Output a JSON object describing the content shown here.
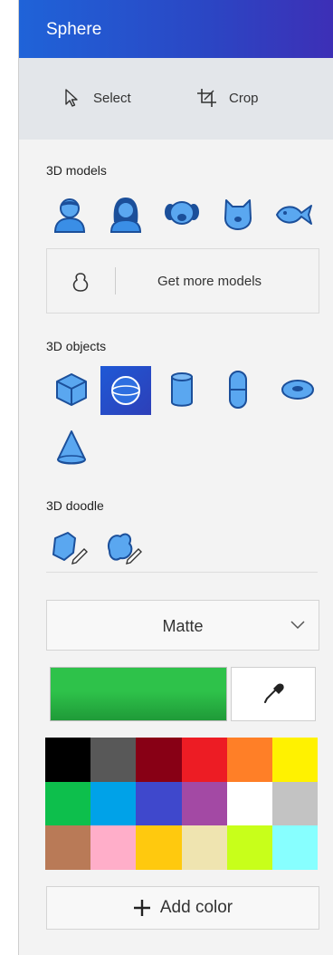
{
  "header": {
    "title": "Sphere"
  },
  "toolbar": {
    "select_label": "Select",
    "crop_label": "Crop"
  },
  "models": {
    "label": "3D models",
    "items": [
      "man-model-icon",
      "woman-model-icon",
      "dog-model-icon",
      "cat-model-icon",
      "fish-model-icon"
    ],
    "get_more_label": "Get more models"
  },
  "objects": {
    "label": "3D objects",
    "items": [
      "cube-icon",
      "sphere-icon",
      "cylinder-icon",
      "capsule-icon",
      "torus-icon",
      "cone-icon"
    ],
    "selected": "sphere-icon"
  },
  "doodle": {
    "label": "3D doodle",
    "items": [
      "sharp-doodle-icon",
      "soft-doodle-icon"
    ]
  },
  "material": {
    "selected": "Matte"
  },
  "current_color": "#2ec24a",
  "palette": [
    "#000000",
    "#585858",
    "#880015",
    "#ed1c24",
    "#ff7f27",
    "#fff200",
    "#0dbf4c",
    "#00a2e8",
    "#3f48cc",
    "#a349a4",
    "#ffffff",
    "#c3c3c3",
    "#b97a57",
    "#ffaec9",
    "#ffc90e",
    "#efe4b0",
    "#c8ff1a",
    "#87ffff"
  ],
  "add_color_label": "Add color",
  "colors": {
    "accent": "#1f63d8",
    "icon_blue": "#3a8ee6",
    "icon_dark": "#1b4f9a"
  }
}
